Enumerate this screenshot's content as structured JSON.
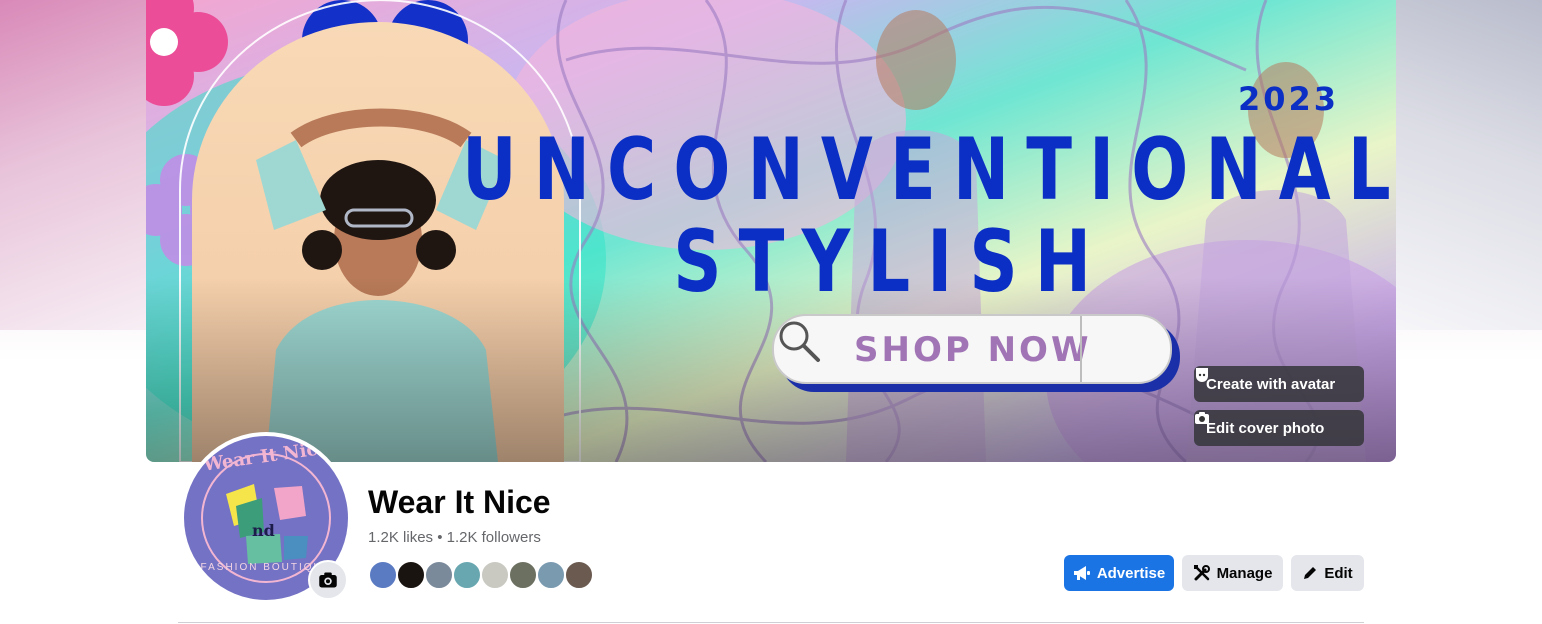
{
  "cover": {
    "title_line1": "UNCONVENTIONALLY",
    "title_line2": "STYLISH",
    "year": "2023",
    "shop_label": "SHOP NOW",
    "create_avatar_label": "Create with avatar",
    "edit_cover_label": "Edit cover photo"
  },
  "profile": {
    "logo_text_top": "Wear It Nice",
    "logo_text_mid": "nd",
    "logo_text_bottom": "FASHION BOUTIQUE",
    "name": "Wear It Nice",
    "stats": "1.2K likes • 1.2K followers"
  },
  "actions": {
    "advertise": "Advertise",
    "manage": "Manage",
    "edit": "Edit"
  },
  "colors": {
    "accent": "#1b74e4",
    "title_blue": "#0b2fc4",
    "button_grey": "#e4e6eb"
  },
  "icons": [
    "avatar-icon",
    "camera-icon",
    "megaphone-icon",
    "manage-tools-icon",
    "pencil-icon",
    "magnifier-icon"
  ]
}
